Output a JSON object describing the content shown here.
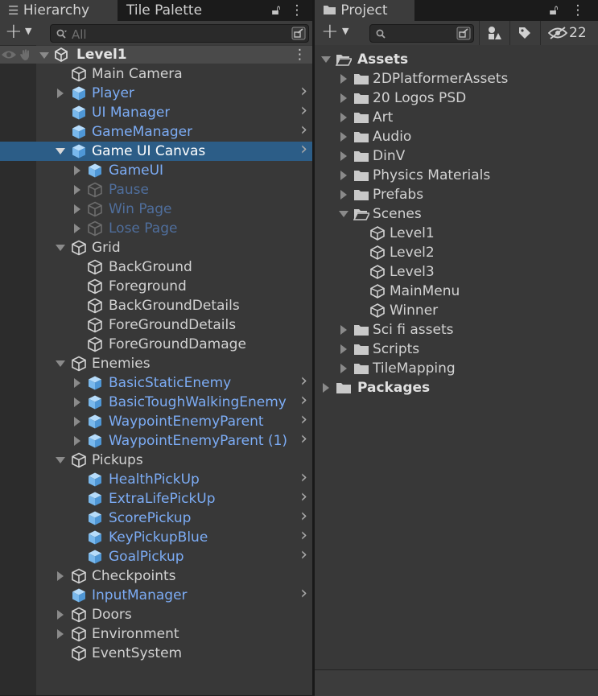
{
  "hierarchy": {
    "tabs": [
      "Hierarchy",
      "Tile Palette"
    ],
    "search_placeholder": "All",
    "scene_name": "Level1",
    "rows": [
      {
        "label": "Main Camera",
        "indent": 1,
        "expand": "none",
        "type": "go",
        "chev": false
      },
      {
        "label": "Player",
        "indent": 1,
        "expand": "right",
        "type": "prefab",
        "chev": true
      },
      {
        "label": "UI Manager",
        "indent": 1,
        "expand": "none",
        "type": "prefab",
        "chev": true
      },
      {
        "label": "GameManager",
        "indent": 1,
        "expand": "none",
        "type": "prefab",
        "chev": true
      },
      {
        "label": "Game UI Canvas",
        "indent": 1,
        "expand": "down",
        "type": "prefab-sel",
        "chev": true,
        "selected": true
      },
      {
        "label": "GameUI",
        "indent": 2,
        "expand": "right",
        "type": "prefab",
        "chev": false
      },
      {
        "label": "Pause",
        "indent": 2,
        "expand": "right",
        "type": "prefab-off",
        "chev": false
      },
      {
        "label": "Win Page",
        "indent": 2,
        "expand": "right",
        "type": "prefab-off",
        "chev": false
      },
      {
        "label": "Lose Page",
        "indent": 2,
        "expand": "right",
        "type": "prefab-off",
        "chev": false
      },
      {
        "label": "Grid",
        "indent": 1,
        "expand": "down",
        "type": "go",
        "chev": false
      },
      {
        "label": "BackGround",
        "indent": 2,
        "expand": "none",
        "type": "go",
        "chev": false
      },
      {
        "label": "Foreground",
        "indent": 2,
        "expand": "none",
        "type": "go",
        "chev": false
      },
      {
        "label": "BackGroundDetails",
        "indent": 2,
        "expand": "none",
        "type": "go",
        "chev": false
      },
      {
        "label": "ForeGroundDetails",
        "indent": 2,
        "expand": "none",
        "type": "go",
        "chev": false
      },
      {
        "label": "ForeGroundDamage",
        "indent": 2,
        "expand": "none",
        "type": "go",
        "chev": false
      },
      {
        "label": "Enemies",
        "indent": 1,
        "expand": "down",
        "type": "go",
        "chev": false
      },
      {
        "label": "BasicStaticEnemy",
        "indent": 2,
        "expand": "right",
        "type": "prefab",
        "chev": true
      },
      {
        "label": "BasicToughWalkingEnemy",
        "indent": 2,
        "expand": "right",
        "type": "prefab",
        "chev": true
      },
      {
        "label": "WaypointEnemyParent",
        "indent": 2,
        "expand": "right",
        "type": "prefab",
        "chev": true
      },
      {
        "label": "WaypointEnemyParent (1)",
        "indent": 2,
        "expand": "right",
        "type": "prefab",
        "chev": true
      },
      {
        "label": "Pickups",
        "indent": 1,
        "expand": "down",
        "type": "go",
        "chev": false
      },
      {
        "label": "HealthPickUp",
        "indent": 2,
        "expand": "none",
        "type": "prefab",
        "chev": true
      },
      {
        "label": "ExtraLifePickUp",
        "indent": 2,
        "expand": "none",
        "type": "prefab",
        "chev": true
      },
      {
        "label": "ScorePickup",
        "indent": 2,
        "expand": "none",
        "type": "prefab",
        "chev": true
      },
      {
        "label": "KeyPickupBlue",
        "indent": 2,
        "expand": "none",
        "type": "prefab",
        "chev": true
      },
      {
        "label": "GoalPickup",
        "indent": 2,
        "expand": "none",
        "type": "prefab",
        "chev": true
      },
      {
        "label": "Checkpoints",
        "indent": 1,
        "expand": "right",
        "type": "go",
        "chev": false
      },
      {
        "label": "InputManager",
        "indent": 1,
        "expand": "none",
        "type": "prefab",
        "chev": true
      },
      {
        "label": "Doors",
        "indent": 1,
        "expand": "right",
        "type": "go",
        "chev": false
      },
      {
        "label": "Environment",
        "indent": 1,
        "expand": "right",
        "type": "go",
        "chev": false
      },
      {
        "label": "EventSystem",
        "indent": 1,
        "expand": "none",
        "type": "go",
        "chev": false
      }
    ]
  },
  "project": {
    "tab": "Project",
    "hidden_count": "22",
    "rows": [
      {
        "label": "Assets",
        "indent": 0,
        "expand": "down",
        "icon": "folder-open",
        "bold": true
      },
      {
        "label": "2DPlatformerAssets",
        "indent": 1,
        "expand": "right",
        "icon": "folder"
      },
      {
        "label": "20 Logos PSD",
        "indent": 1,
        "expand": "right",
        "icon": "folder"
      },
      {
        "label": "Art",
        "indent": 1,
        "expand": "right",
        "icon": "folder"
      },
      {
        "label": "Audio",
        "indent": 1,
        "expand": "right",
        "icon": "folder"
      },
      {
        "label": "DinV",
        "indent": 1,
        "expand": "right",
        "icon": "folder"
      },
      {
        "label": "Physics Materials",
        "indent": 1,
        "expand": "right",
        "icon": "folder"
      },
      {
        "label": "Prefabs",
        "indent": 1,
        "expand": "right",
        "icon": "folder"
      },
      {
        "label": "Scenes",
        "indent": 1,
        "expand": "down",
        "icon": "folder-open"
      },
      {
        "label": "Level1",
        "indent": 2,
        "expand": "none",
        "icon": "unity"
      },
      {
        "label": "Level2",
        "indent": 2,
        "expand": "none",
        "icon": "unity"
      },
      {
        "label": "Level3",
        "indent": 2,
        "expand": "none",
        "icon": "unity"
      },
      {
        "label": "MainMenu",
        "indent": 2,
        "expand": "none",
        "icon": "unity"
      },
      {
        "label": "Winner",
        "indent": 2,
        "expand": "none",
        "icon": "unity"
      },
      {
        "label": "Sci fi assets",
        "indent": 1,
        "expand": "right",
        "icon": "folder"
      },
      {
        "label": "Scripts",
        "indent": 1,
        "expand": "right",
        "icon": "folder"
      },
      {
        "label": "TileMapping",
        "indent": 1,
        "expand": "right",
        "icon": "folder"
      },
      {
        "label": "Packages",
        "indent": 0,
        "expand": "right",
        "icon": "folder",
        "bold": true
      }
    ]
  }
}
